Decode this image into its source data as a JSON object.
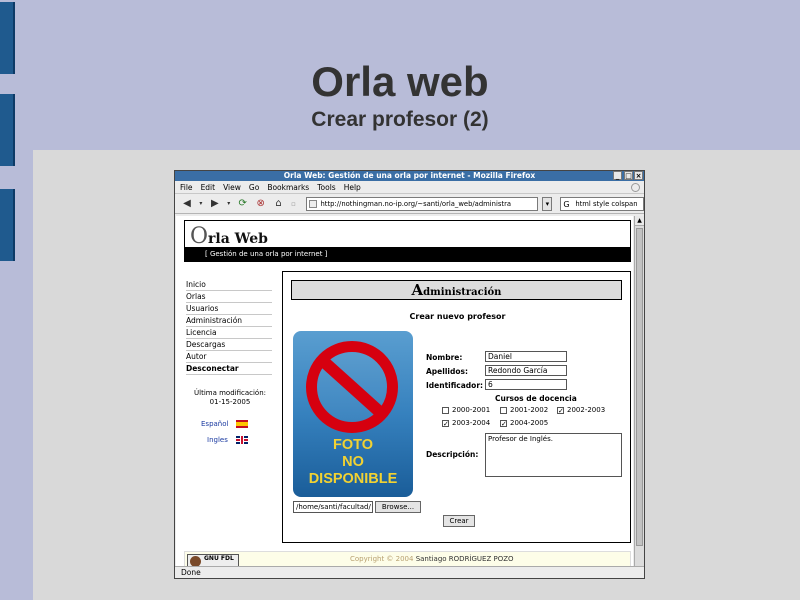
{
  "slide": {
    "title": "Orla web",
    "subtitle": "Crear profesor (2)"
  },
  "browser": {
    "window_title": "Orla Web: Gestión de una orla por internet - Mozilla Firefox",
    "menu": [
      "File",
      "Edit",
      "View",
      "Go",
      "Bookmarks",
      "Tools",
      "Help"
    ],
    "url": "http://nothingman.no-ip.org/~santi/orla_web/administra",
    "search_value": "html style colspan",
    "status": "Done"
  },
  "site": {
    "logo_first": "O",
    "logo_rest": "rla Web",
    "tagline": "[ Gestión de una orla por internet ]",
    "menu": [
      {
        "label": "Inicio",
        "bold": false
      },
      {
        "label": "Orlas",
        "bold": false
      },
      {
        "label": "Usuarios",
        "bold": false
      },
      {
        "label": "Administración",
        "bold": false
      },
      {
        "label": "Licencia",
        "bold": false
      },
      {
        "label": "Descargas",
        "bold": false
      },
      {
        "label": "Autor",
        "bold": false
      },
      {
        "label": "Desconectar",
        "bold": true
      }
    ],
    "last_mod_label": "Última modificación:",
    "last_mod_date": "01-15-2005",
    "lang_es": "Español",
    "lang_en": "Ingles",
    "footer_badge": "GNU FDL",
    "copyright": "Copyright © 2004",
    "author": "Santiago RODRÍGUEZ POZO"
  },
  "admin": {
    "header_first": "A",
    "header_rest": "dministración",
    "form_title": "Crear nuevo profesor",
    "photo_lines": [
      "FOTO",
      "NO",
      "DISPONIBLE"
    ],
    "nombre_label": "Nombre:",
    "nombre_value": "Daniel",
    "apellidos_label": "Apellidos:",
    "apellidos_value": "Redondo García",
    "identificador_label": "Identificador:",
    "identificador_value": "6",
    "cursos_label": "Cursos de docencia",
    "cursos": [
      {
        "label": "2000-2001",
        "checked": false
      },
      {
        "label": "2001-2002",
        "checked": false
      },
      {
        "label": "2002-2003",
        "checked": true
      },
      {
        "label": "2003-2004",
        "checked": true
      },
      {
        "label": "2004-2005",
        "checked": true
      }
    ],
    "descripcion_label": "Descripción:",
    "descripcion_value": "Profesor de Inglés.",
    "file_value": "/home/santi/facultad/",
    "browse_label": "Browse...",
    "crear_label": "Crear"
  }
}
